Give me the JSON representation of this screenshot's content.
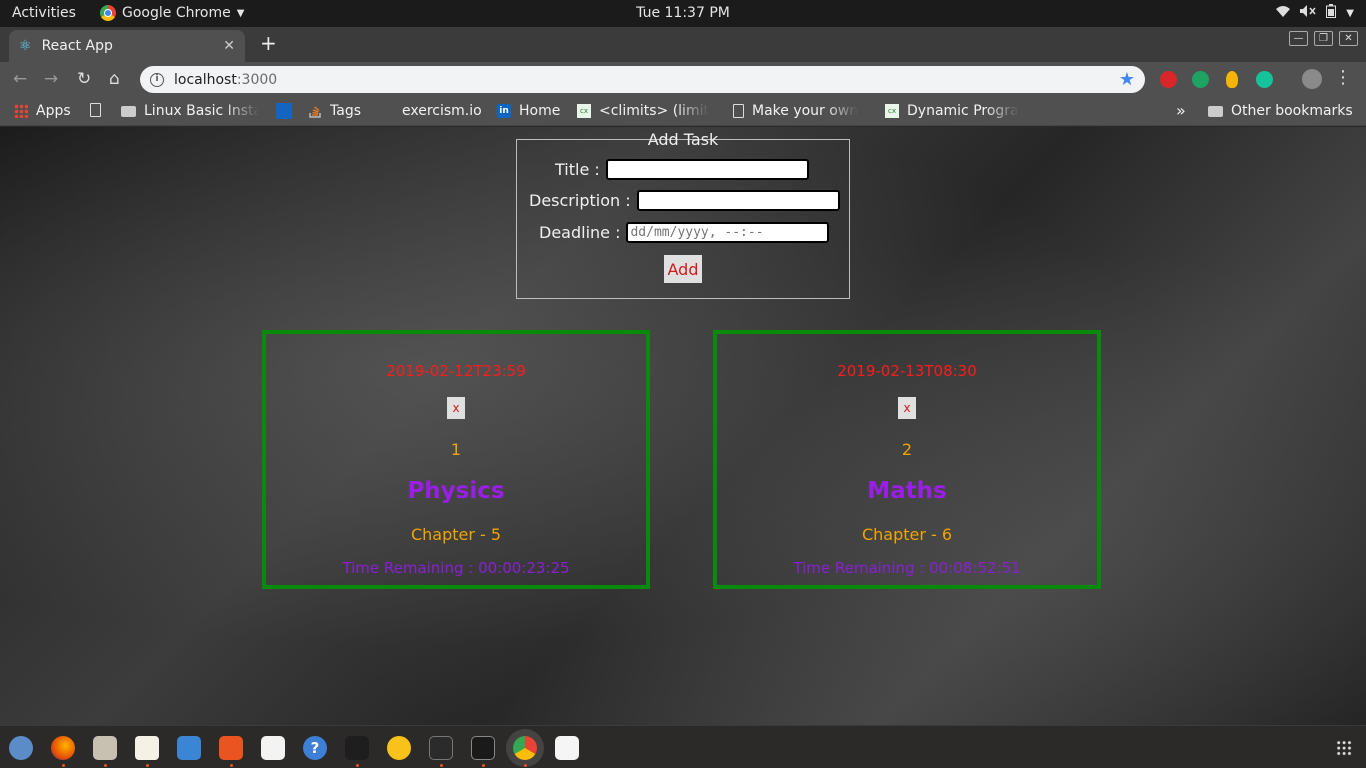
{
  "system_bar": {
    "activities": "Activities",
    "app_name": "Google Chrome",
    "clock": "Tue 11:37 PM"
  },
  "browser": {
    "tab_title": "React App",
    "url_host": "localhost",
    "url_port": ":3000",
    "bookmarks": [
      "Apps",
      "Linux Basic Insta",
      "Tags",
      "exercism.io",
      "Home",
      "<climits> (limits",
      "Make your own",
      "Dynamic Progra",
      "Other bookmarks"
    ],
    "overflow_label": "»"
  },
  "form": {
    "legend": "Add Task",
    "title_label": "Title :",
    "description_label": "Description :",
    "deadline_label": "Deadline :",
    "deadline_placeholder": "dd/mm/yyyy, --:--",
    "add_label": "Add"
  },
  "tasks": [
    {
      "deadline": "2019-02-12T23:59",
      "delete_label": "x",
      "number": "1",
      "title": "Physics",
      "description": "Chapter - 5",
      "remaining": "Time Remaining : 00:00:23:25"
    },
    {
      "deadline": "2019-02-13T08:30",
      "delete_label": "x",
      "number": "2",
      "title": "Maths",
      "description": "Chapter - 6",
      "remaining": "Time Remaining : 00:08:52:51"
    }
  ],
  "colors": {
    "card_border": "#0a8a0a",
    "deadline": "#ff1a1a",
    "number": "#f0a500",
    "title": "#9b1de8"
  }
}
